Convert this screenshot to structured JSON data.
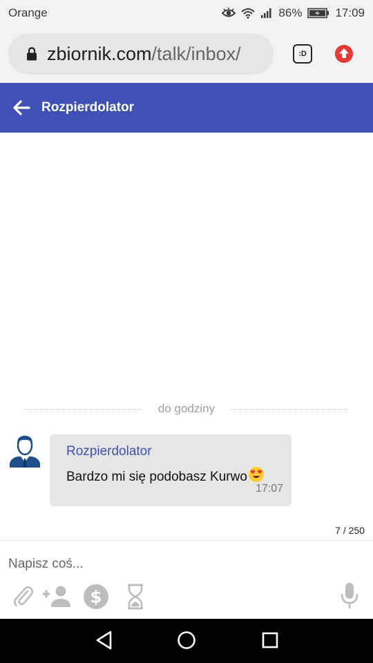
{
  "status_bar": {
    "carrier": "Orange",
    "battery": "86%",
    "time": "17:09"
  },
  "browser": {
    "url_domain": "zbiornik.com",
    "url_path": "/talk/inbox/",
    "tab_icon_text": ":D"
  },
  "header": {
    "title": "Rozpierdolator"
  },
  "chat": {
    "divider_label": "do godziny",
    "messages": [
      {
        "sender": "Rozpierdolator",
        "text": "Bardzo mi się podobasz Kurwo",
        "time": "17:07"
      }
    ]
  },
  "composer": {
    "char_count": "7 / 250",
    "placeholder": "Napisz coś..."
  },
  "colors": {
    "header_bg": "#3f51b5",
    "sender_name": "#3f51b5",
    "bubble_bg": "#e6e6e6",
    "upload_badge": "#e53935"
  },
  "icons": [
    "lock-icon",
    "tab-switcher-icon",
    "upload-icon",
    "back-arrow-icon",
    "user-avatar",
    "heart-eyes-emoji",
    "attachment-icon",
    "add-person-icon",
    "dollar-icon",
    "hourglass-icon",
    "microphone-icon",
    "nav-back-icon",
    "nav-home-icon",
    "nav-recents-icon"
  ]
}
